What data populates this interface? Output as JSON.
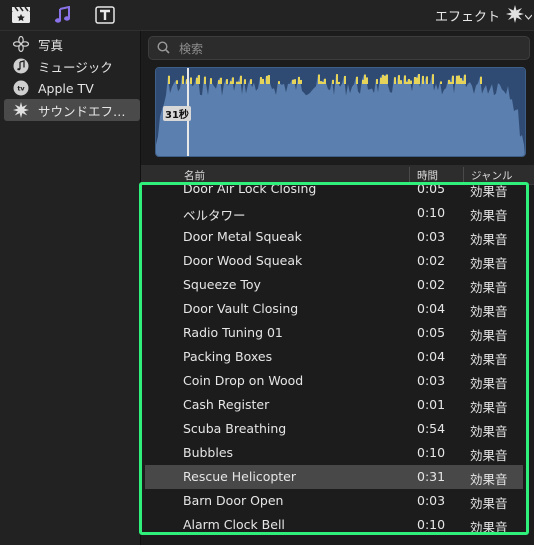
{
  "toolbar": {
    "icons": [
      "clapperboard-star-icon",
      "music-notes-icon",
      "title-t-icon"
    ],
    "effects_title": "エフェクト",
    "effects_icon": "starburst-icon"
  },
  "sidebar": {
    "items": [
      {
        "label": "写真",
        "icon": "photos-flower-icon",
        "selected": false
      },
      {
        "label": "ミュージック",
        "icon": "music-note-icon",
        "selected": false
      },
      {
        "label": "Apple TV",
        "icon": "apple-tv-icon",
        "selected": false
      },
      {
        "label": "サウンドエフ…",
        "icon": "starburst-icon",
        "selected": true
      }
    ]
  },
  "search": {
    "placeholder": "検索",
    "value": ""
  },
  "waveform": {
    "playhead_label": "31秒",
    "colors": {
      "wave": "#5b7fae",
      "peak": "#e6d35a"
    }
  },
  "table": {
    "headers": {
      "name": "名前",
      "time": "時間",
      "genre": "ジャンル"
    },
    "rows": [
      {
        "name": "Door Air Lock Closing",
        "time": "0:05",
        "genre": "効果音",
        "selected": false
      },
      {
        "name": "ベルタワー",
        "time": "0:10",
        "genre": "効果音",
        "selected": false
      },
      {
        "name": "Door Metal Squeak",
        "time": "0:03",
        "genre": "効果音",
        "selected": false
      },
      {
        "name": "Door Wood Squeak",
        "time": "0:02",
        "genre": "効果音",
        "selected": false
      },
      {
        "name": "Squeeze Toy",
        "time": "0:02",
        "genre": "効果音",
        "selected": false
      },
      {
        "name": "Door Vault Closing",
        "time": "0:04",
        "genre": "効果音",
        "selected": false
      },
      {
        "name": "Radio Tuning 01",
        "time": "0:05",
        "genre": "効果音",
        "selected": false
      },
      {
        "name": "Packing Boxes",
        "time": "0:04",
        "genre": "効果音",
        "selected": false
      },
      {
        "name": "Coin Drop on Wood",
        "time": "0:03",
        "genre": "効果音",
        "selected": false
      },
      {
        "name": "Cash Register",
        "time": "0:01",
        "genre": "効果音",
        "selected": false
      },
      {
        "name": "Scuba Breathing",
        "time": "0:54",
        "genre": "効果音",
        "selected": false
      },
      {
        "name": "Bubbles",
        "time": "0:10",
        "genre": "効果音",
        "selected": false
      },
      {
        "name": "Rescue Helicopter",
        "time": "0:31",
        "genre": "効果音",
        "selected": true
      },
      {
        "name": "Barn Door Open",
        "time": "0:03",
        "genre": "効果音",
        "selected": false
      },
      {
        "name": "Alarm Clock Bell",
        "time": "0:10",
        "genre": "効果音",
        "selected": false
      }
    ]
  },
  "colors": {
    "accent_highlight": "#2ef07a",
    "selected_row": "#484848"
  }
}
